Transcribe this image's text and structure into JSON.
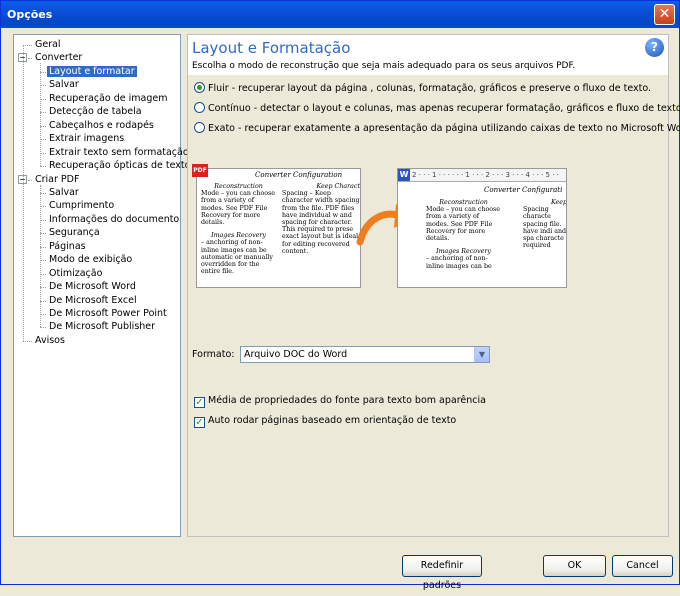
{
  "window": {
    "title": "Opções",
    "close_glyph": "✕"
  },
  "sidebar": {
    "items": [
      {
        "label": "Geral",
        "level": 0
      },
      {
        "label": "Converter",
        "level": 0,
        "expanded": true
      },
      {
        "label": "Layout e formatar",
        "level": 1,
        "selected": true
      },
      {
        "label": "Salvar",
        "level": 1
      },
      {
        "label": "Recuperação de imagem",
        "level": 1
      },
      {
        "label": "Detecção de tabela",
        "level": 1
      },
      {
        "label": "Cabeçalhos e rodapés",
        "level": 1
      },
      {
        "label": "Extrair imagens",
        "level": 1
      },
      {
        "label": "Extrair texto sem formatação",
        "level": 1
      },
      {
        "label": "Recuperação ópticas de texto",
        "level": 1
      },
      {
        "label": "Criar PDF",
        "level": 0,
        "expanded": true
      },
      {
        "label": "Salvar",
        "level": 1
      },
      {
        "label": "Cumprimento",
        "level": 1
      },
      {
        "label": "Informações do documento",
        "level": 1
      },
      {
        "label": "Segurança",
        "level": 1
      },
      {
        "label": "Páginas",
        "level": 1
      },
      {
        "label": "Modo de exibição",
        "level": 1
      },
      {
        "label": "Otimização",
        "level": 1
      },
      {
        "label": "De Microsoft Word",
        "level": 1
      },
      {
        "label": "De Microsoft Excel",
        "level": 1
      },
      {
        "label": "De Microsoft Power Point",
        "level": 1
      },
      {
        "label": "De Microsoft Publisher",
        "level": 1
      },
      {
        "label": "Avisos",
        "level": 0
      }
    ]
  },
  "main": {
    "title": "Layout e Formatação",
    "subtitle": "Escolha o modo de reconstrução que seja mais adequado para os seus arquivos PDF.",
    "help_glyph": "?",
    "radios": [
      {
        "label": "Fluir - recuperar layout da página , colunas, formatação, gráficos e preserve o fluxo de texto.",
        "checked": true
      },
      {
        "label": "Contínuo - detectar o layout e colunas, mas apenas recuperar formatação, gráficos e fluxo de texto.",
        "checked": false
      },
      {
        "label": "Exato - recuperar exatamente a apresentação da página utilizando caixas de texto no Microsoft Word.",
        "checked": false
      }
    ],
    "preview": {
      "pdf_badge": "PDF",
      "word_badge": "W",
      "doc_title_pdf": "Converter Configuration",
      "doc_title_word": "Converter Configurati",
      "ruler": "2 · · · 1 · · · · · · 1 · · · 2 · · · 3 · · · 4 · · · 5 · ·",
      "pdf_col1_head": "Reconstruction",
      "pdf_col1_text": "Mode – you can choose from a variety of modes. See PDF File Recovery for more details.",
      "pdf_col1_head2": "Images Recovery",
      "pdf_col1_text2": "– anchoring of non-inline images can be automatic or manually overridden for the entire file.",
      "pdf_col2_head": "Keep Charact",
      "pdf_col2_text": "Spacing – Keep character width spacing from the file. PDF files have individual w and spacing for character. This required to prese exact layout but is ideal for editing recovered content.",
      "word_col1_head": "Reconstruction",
      "word_col1_text": "Mode – you can choose from a variety of modes. See PDF File Recovery for more details.",
      "word_col1_head2": "Images Recovery",
      "word_col1_text2": "– anchoring of non-inline images can be",
      "word_col2_head": "Keep",
      "word_col2_text": "Spacing characte spacing file. have indi and spa characte required"
    },
    "format_label": "Formato:",
    "format_value": "Arquivo DOC do Word",
    "checkboxes": [
      {
        "label": "Média de propriedades do fonte para texto bom aparência",
        "checked": true
      },
      {
        "label": "Auto rodar páginas baseado em orientação de texto",
        "checked": true
      }
    ]
  },
  "footer": {
    "reset_label": "Redefinir padrões",
    "ok_label": "OK",
    "cancel_label": "Cancel"
  },
  "colors": {
    "accent": "#316ac5",
    "title_blue": "#3169c6",
    "arrow_orange": "#f07d1e"
  }
}
